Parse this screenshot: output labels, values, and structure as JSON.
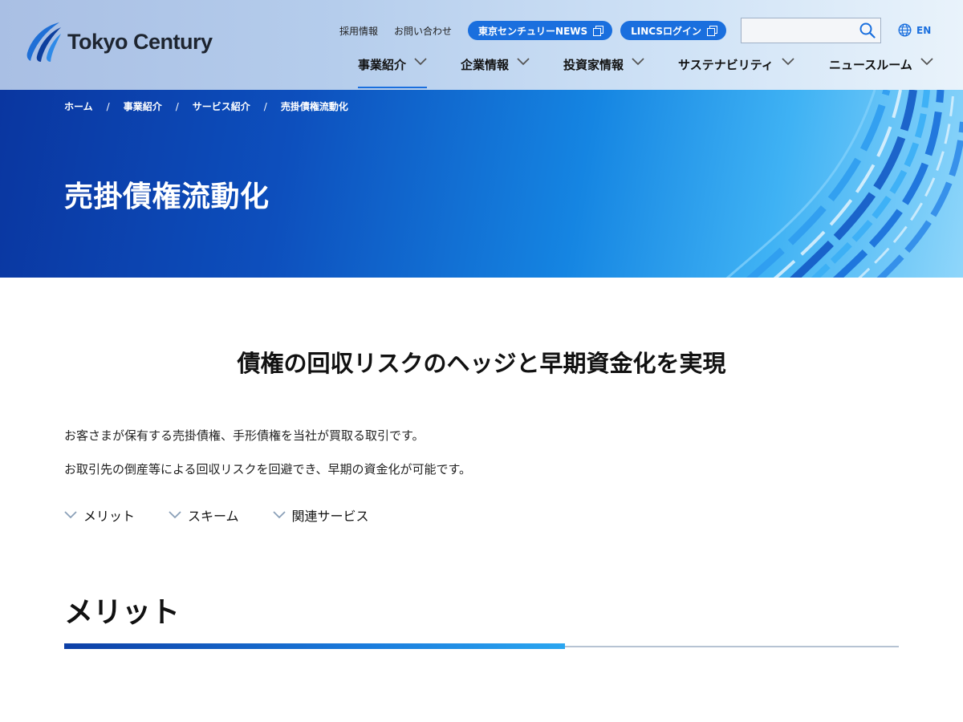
{
  "header": {
    "logo_text": "Tokyo Century",
    "util_links": [
      "採用情報",
      "お問い合わせ"
    ],
    "pill_links": [
      "東京センチュリーNEWS",
      "LINCSログイン"
    ],
    "search": {
      "value": "",
      "placeholder": ""
    },
    "lang": "EN",
    "nav": [
      {
        "label": "事業紹介",
        "active": true
      },
      {
        "label": "企業情報",
        "active": false
      },
      {
        "label": "投資家情報",
        "active": false
      },
      {
        "label": "サステナビリティ",
        "active": false
      },
      {
        "label": "ニュースルーム",
        "active": false
      }
    ]
  },
  "hero": {
    "breadcrumb": [
      "ホーム",
      "事業紹介",
      "サービス紹介",
      "売掛債権流動化"
    ],
    "breadcrumb_separator": "/",
    "title": "売掛債権流動化"
  },
  "main": {
    "lead": "債権の回収リスクのヘッジと早期資金化を実現",
    "paragraphs": [
      "お客さまが保有する売掛債権、手形債権を当社が買取る取引です。",
      "お取引先の倒産等による回収リスクを回避でき、早期の資金化が可能です。"
    ],
    "anchors": [
      "メリット",
      "スキーム",
      "関連サービス"
    ],
    "section_title": "メリット"
  },
  "colors": {
    "brand_blue": "#1a6fde",
    "hero_dark": "#0a36a0",
    "hero_light": "#8fd6fa",
    "text": "#111111"
  },
  "icons": [
    "logo-swoosh-icon",
    "external-link-icon",
    "search-icon",
    "globe-icon",
    "chevron-down-icon"
  ]
}
